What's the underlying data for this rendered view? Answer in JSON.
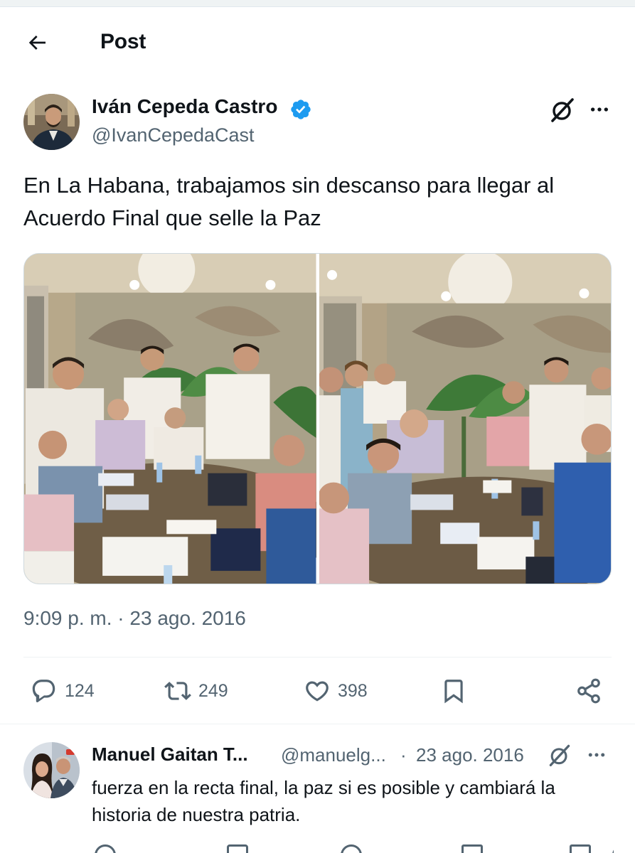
{
  "header": {
    "title": "Post",
    "back_icon": "arrow-left-icon"
  },
  "tweet": {
    "author_name": "Iván Cepeda Castro",
    "author_handle": "@IvanCepedaCast",
    "verified": true,
    "text": "En La Habana, trabajamos sin descanso para llegar al Acuerdo Final que selle la Paz",
    "photos": 2,
    "timestamp": "9:09 p. m. · 23 ago. 2016",
    "replies": "124",
    "reposts": "249",
    "likes": "398"
  },
  "reply": {
    "author_name": "Manuel Gaitan T...",
    "author_handle": "@manuelg...",
    "separator": "·",
    "date": "23 ago. 2016",
    "text": "fuerza en la recta final, la paz si es posible y cambiará la historia de nuestra patria."
  },
  "colors": {
    "text_primary": "#0f1419",
    "text_secondary": "#536471",
    "verified_blue": "#1d9bf0",
    "divider": "#eff3f4"
  }
}
